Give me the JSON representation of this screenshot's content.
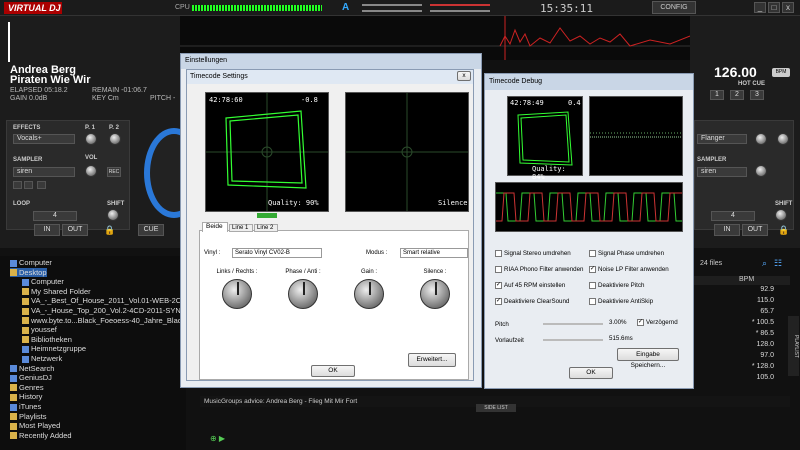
{
  "app": {
    "logo": "VIRTUAL DJ",
    "cpu_label": "CPU",
    "clock": "15:35:11",
    "config_label": "CONFIG",
    "win_buttons": [
      "_",
      "□",
      "x"
    ],
    "deck_numbers": [
      "1",
      "2",
      "3"
    ]
  },
  "deck_left": {
    "artist": "Andrea Berg",
    "title": "Piraten Wie Wir",
    "elapsed": "ELAPSED 05:18.2",
    "remain": "REMAIN -01:06.7",
    "gain": "GAIN 0.0dB",
    "key": "KEY Cm",
    "pitch": "PITCH -",
    "effects_label": "EFFECTS",
    "effect_value": "Vocals+",
    "p1": "P. 1",
    "p2": "P. 2",
    "sampler_label": "SAMPLER",
    "sampler_value": "siren",
    "vol": "VOL",
    "rec": "REC",
    "loop_label": "LOOP",
    "loop_value": "4",
    "shift": "SHIFT",
    "in_btn": "IN",
    "out_btn": "OUT",
    "cue": "CUE"
  },
  "deck_right": {
    "bpm": "126.00",
    "bpm_unit": "BPM",
    "hot_cue": "HOT CUE",
    "hot_cues": [
      "1",
      "2",
      "3"
    ],
    "effect_value": "Flanger",
    "sampler_label": "SAMPLER",
    "sampler_value": "siren",
    "loop_value": "4",
    "shift": "SHIFT",
    "in_btn": "IN",
    "out_btn": "OUT"
  },
  "browser": {
    "tree": [
      {
        "label": "Computer",
        "indent": 0,
        "blue": true
      },
      {
        "label": "Desktop",
        "indent": 0,
        "selected": true
      },
      {
        "label": "Computer",
        "indent": 1,
        "blue": true
      },
      {
        "label": "My Shared Folder",
        "indent": 1
      },
      {
        "label": "VA_-_Best_Of_House_2011_Vol.01-WEB-2C...",
        "indent": 1
      },
      {
        "label": "VA_-_House_Top_200_Vol.2-4CD-2011-SYN...",
        "indent": 1
      },
      {
        "label": "www.byte.to...Black_Foeoess-40_Jahre_Blac...",
        "indent": 1
      },
      {
        "label": "youssef",
        "indent": 1
      },
      {
        "label": "Bibliotheken",
        "indent": 1
      },
      {
        "label": "Heimnetzgruppe",
        "indent": 1,
        "blue": true
      },
      {
        "label": "Netzwerk",
        "indent": 1,
        "blue": true
      },
      {
        "label": "NetSearch",
        "indent": 0,
        "blue": true
      },
      {
        "label": "GeniusDJ",
        "indent": 0,
        "blue": true
      },
      {
        "label": "Genres",
        "indent": 0
      },
      {
        "label": "History",
        "indent": 0
      },
      {
        "label": "iTunes",
        "indent": 0,
        "blue": true
      },
      {
        "label": "Playlists",
        "indent": 0
      },
      {
        "label": "Most Played",
        "indent": 0
      },
      {
        "label": "Recently Added",
        "indent": 0
      }
    ],
    "files_count": "24 files",
    "bpm_header": "BPM",
    "bpm_values": [
      "92.9",
      "115.0",
      "65.7",
      "* 100.5",
      "* 86.5",
      "128.0",
      "97.0",
      "* 128.0",
      "105.0"
    ],
    "advice": "MusicGroups advice: Andrea Berg - Flieg Mit Mir Fort",
    "side_list": "SIDE LIST",
    "playlist_tab": "PLAYLIST"
  },
  "dlg_settings": {
    "outer_title": "Einstellungen",
    "title": "Timecode Settings",
    "close": "x",
    "scope1_time": "42:78:60",
    "scope1_val": "-0.8",
    "scope1_quality": "Quality: 90%",
    "scope2_label": "Silence",
    "tabs": [
      "Beide",
      "Line 1",
      "Line 2"
    ],
    "vinyl_label": "Vinyl :",
    "vinyl_value": "Serato Vinyl CV02-B",
    "modus_label": "Modus :",
    "modus_value": "Smart relative",
    "knob_labels": [
      "Links / Rechts :",
      "Phase / Anti :",
      "Gain :",
      "Silence :"
    ],
    "erweitert_btn": "Erweitert...",
    "ok_btn": "OK"
  },
  "dlg_debug": {
    "title": "Timecode Debug",
    "time": "42:78:49",
    "val": "0.4",
    "quality": "Quality: 84%",
    "checks": [
      {
        "label": "Signal Stereo umdrehen",
        "checked": false
      },
      {
        "label": "Signal Phase umdrehen",
        "checked": false
      },
      {
        "label": "RIAA Phono Filter anwenden",
        "checked": false
      },
      {
        "label": "Noise LP Filter anwenden",
        "checked": true
      },
      {
        "label": "Auf 45 RPM einstellen",
        "checked": true
      },
      {
        "label": "Deaktiviere Pitch",
        "checked": false
      },
      {
        "label": "Deaktiviere ClearSound",
        "checked": true
      },
      {
        "label": "Deaktiviere AntiSkip",
        "checked": false
      }
    ],
    "pitch_label": "Pitch",
    "pitch_value": "3.00%",
    "verzoegernd_label": "Verzögernd",
    "vorlaufzeit_label": "Vorlaufzeit",
    "vorlaufzeit_value": "515.6ms",
    "save_btn": "Eingabe Speichern...",
    "ok_btn": "OK"
  }
}
